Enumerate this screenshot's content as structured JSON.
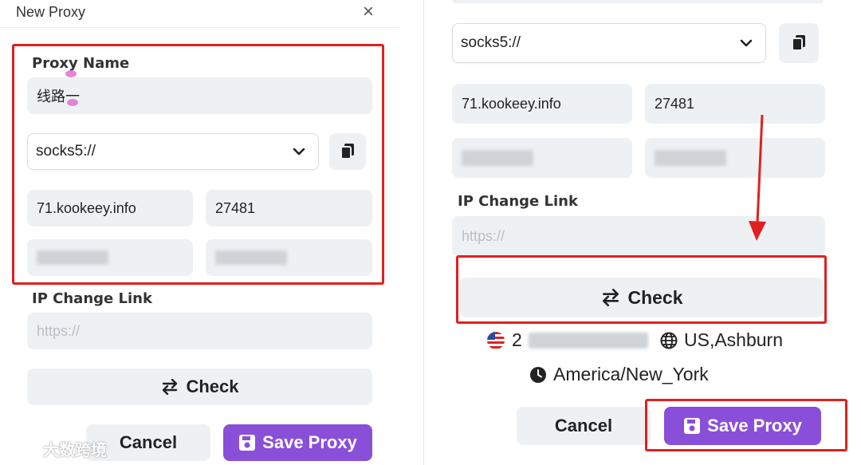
{
  "left": {
    "dialog_title": "New Proxy",
    "close_icon": "×",
    "proxy_name_label": "Proxy Name",
    "proxy_name_value": "线路一",
    "protocol": "socks5://",
    "host": "71.kookeey.info",
    "port": "27481",
    "ip_change_label": "IP Change Link",
    "ip_change_placeholder": "https://",
    "check_label": "Check",
    "cancel_label": "Cancel",
    "save_label": "Save Proxy"
  },
  "right": {
    "protocol": "socks5://",
    "host": "71.kookeey.info",
    "port": "27481",
    "ip_change_label": "IP Change Link",
    "ip_change_placeholder": "https://",
    "check_label": "Check",
    "ip_prefix": "2",
    "location": "US,Ashburn",
    "timezone": "America/New_York",
    "cancel_label": "Cancel",
    "save_label": "Save Proxy"
  },
  "watermark": "大数跨境",
  "colors": {
    "accent": "#8a4fd8",
    "highlight": "#e02020",
    "field_bg": "#eef1f4"
  }
}
